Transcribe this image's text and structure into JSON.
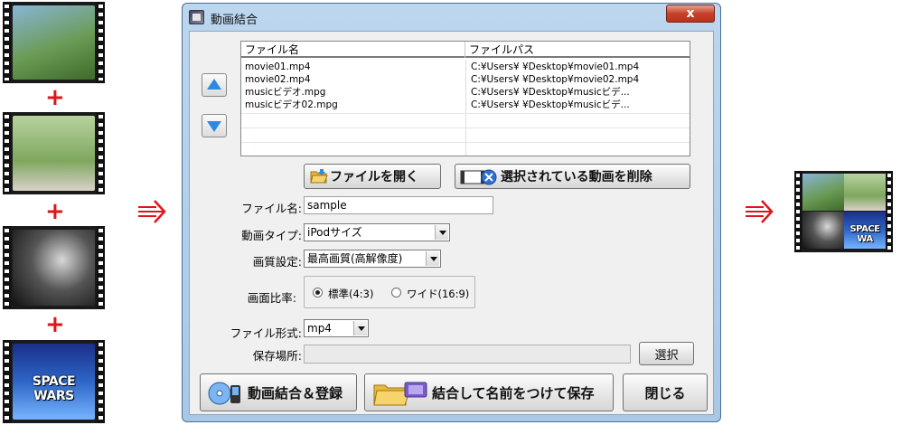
{
  "illustration": {
    "left_thumbnails": [
      {
        "name": "dog-thumbnail"
      },
      {
        "name": "guitar-woman-thumbnail"
      },
      {
        "name": "dancer-thumbnail"
      },
      {
        "name": "space-wars-thumbnail",
        "text": "SPACE WARS"
      }
    ],
    "plus_sign": "+",
    "result_text": "SPACE WA"
  },
  "window": {
    "title": "動画結合",
    "close_label": "x"
  },
  "table": {
    "columns": [
      "ファイル名",
      "ファイルパス"
    ],
    "rows": [
      {
        "name": "movie01.mp4",
        "path": "C:¥Users¥          ¥Desktop¥movie01.mp4"
      },
      {
        "name": "movie02.mp4",
        "path": "C:¥Users¥          ¥Desktop¥movie02.mp4"
      },
      {
        "name": "musicビデオ.mpg",
        "path": "C:¥Users¥          ¥Desktop¥musicビデ..."
      },
      {
        "name": "musicビデオ02.mpg",
        "path": "C:¥Users¥          ¥Desktop¥musicビデ..."
      }
    ]
  },
  "buttons": {
    "open_file": "ファイルを開く",
    "delete_selected": "選択されている動画を削除",
    "browse": "選択",
    "merge_register": "動画結合＆登録",
    "merge_save_as": "結合して名前をつけて保存",
    "close": "閉じる"
  },
  "form": {
    "filename_label": "ファイル名:",
    "filename_value": "sample",
    "video_type_label": "動画タイプ:",
    "video_type_value": "iPodサイズ",
    "quality_label": "画質設定:",
    "quality_value": "最高画質(高解像度)",
    "aspect_label": "画面比率:",
    "aspect_options": [
      "標準(4:3)",
      "ワイド(16:9)"
    ],
    "aspect_selected": "標準(4:3)",
    "format_label": "ファイル形式:",
    "format_value": "mp4",
    "save_location_label": "保存場所:",
    "save_location_value": ""
  },
  "colors": {
    "plus_red": "#e0151a",
    "arrow_blue": "#2e8ae0",
    "window_frame": "#bcd6ee"
  }
}
